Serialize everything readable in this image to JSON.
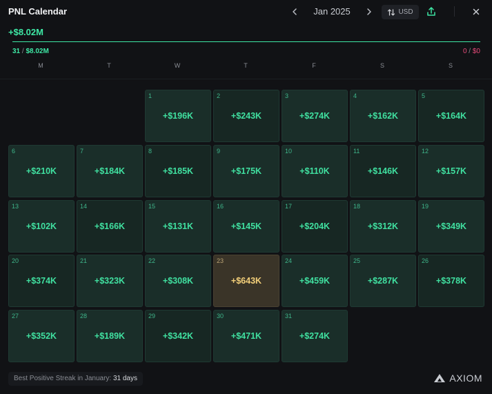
{
  "header": {
    "title": "PNL Calendar",
    "month": "Jan 2025",
    "prev_icon": "chevron-left-icon",
    "next_icon": "chevron-right-icon",
    "currency": "USD",
    "currency_icon": "sort-arrows-icon",
    "share_icon": "share-upload-icon",
    "close_icon": "close-icon"
  },
  "total_pnl": "+$8.02M",
  "summary": {
    "positive_days": "31",
    "positive_amount": "$8.02M",
    "negative_days": "0",
    "negative_amount": "$0"
  },
  "weekdays": [
    "M",
    "T",
    "W",
    "T",
    "F",
    "S",
    "S"
  ],
  "days": [
    {
      "day": "1",
      "pnl": "+$196K"
    },
    {
      "day": "2",
      "pnl": "+$243K"
    },
    {
      "day": "3",
      "pnl": "+$274K"
    },
    {
      "day": "4",
      "pnl": "+$162K"
    },
    {
      "day": "5",
      "pnl": "+$164K"
    },
    {
      "day": "6",
      "pnl": "+$210K"
    },
    {
      "day": "7",
      "pnl": "+$184K"
    },
    {
      "day": "8",
      "pnl": "+$185K"
    },
    {
      "day": "9",
      "pnl": "+$175K"
    },
    {
      "day": "10",
      "pnl": "+$110K"
    },
    {
      "day": "11",
      "pnl": "+$146K"
    },
    {
      "day": "12",
      "pnl": "+$157K"
    },
    {
      "day": "13",
      "pnl": "+$102K"
    },
    {
      "day": "14",
      "pnl": "+$166K"
    },
    {
      "day": "15",
      "pnl": "+$131K"
    },
    {
      "day": "16",
      "pnl": "+$145K"
    },
    {
      "day": "17",
      "pnl": "+$204K"
    },
    {
      "day": "18",
      "pnl": "+$312K"
    },
    {
      "day": "19",
      "pnl": "+$349K"
    },
    {
      "day": "20",
      "pnl": "+$374K"
    },
    {
      "day": "21",
      "pnl": "+$323K"
    },
    {
      "day": "22",
      "pnl": "+$308K"
    },
    {
      "day": "23",
      "pnl": "+$643K",
      "best": true
    },
    {
      "day": "24",
      "pnl": "+$459K"
    },
    {
      "day": "25",
      "pnl": "+$287K"
    },
    {
      "day": "26",
      "pnl": "+$378K"
    },
    {
      "day": "27",
      "pnl": "+$352K"
    },
    {
      "day": "28",
      "pnl": "+$189K"
    },
    {
      "day": "29",
      "pnl": "+$342K"
    },
    {
      "day": "30",
      "pnl": "+$471K"
    },
    {
      "day": "31",
      "pnl": "+$274K"
    }
  ],
  "footer": {
    "streak_label": "Best Positive Streak in January: ",
    "streak_value": "31 days",
    "brand": "AXIOM",
    "brand_icon": "axiom-logo-icon"
  },
  "colors": {
    "positive": "#3ee8a5",
    "negative": "#e84a7a",
    "best_day": "#f4d07a"
  }
}
